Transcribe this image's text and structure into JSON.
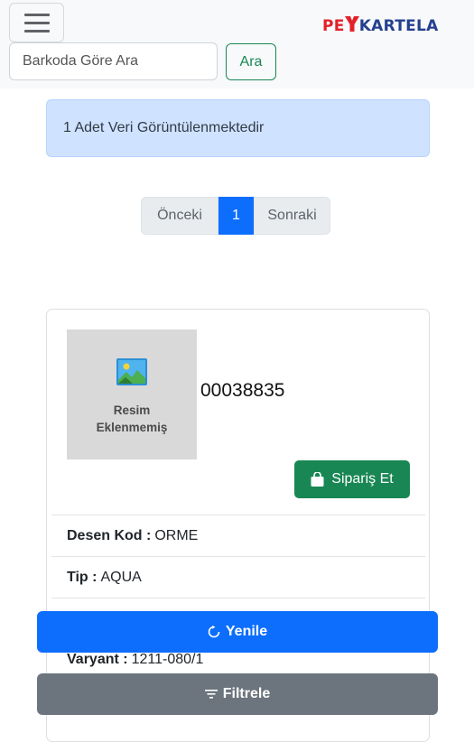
{
  "header": {
    "menu_icon": "hamburger-icon",
    "logo_part1": "PE",
    "logo_part2": "KARTELA",
    "search_placeholder": "Barkoda Göre Ara",
    "search_button": "Ara"
  },
  "alert": {
    "text": "1 Adet Veri Görüntülenmektedir"
  },
  "pagination": {
    "prev": "Önceki",
    "current": "1",
    "next": "Sonraki"
  },
  "product": {
    "image_placeholder": "Resim\nEklenmemiş",
    "barcode": "00038835",
    "order_button": "Sipariş Et",
    "fields": [
      {
        "label": "Desen Kod :",
        "value": "ORME"
      },
      {
        "label": "Tip :",
        "value": "AQUA"
      },
      {
        "label": "Varyant :",
        "value": "1211-080/1"
      }
    ]
  },
  "actions": {
    "refresh": "Yenile",
    "filter": "Filtrele"
  },
  "colors": {
    "primary": "#0d6efd",
    "success": "#198754",
    "secondary": "#6c757d",
    "info_bg": "#cfe2ff",
    "logo_red": "#e4202a",
    "logo_blue": "#25408f"
  }
}
